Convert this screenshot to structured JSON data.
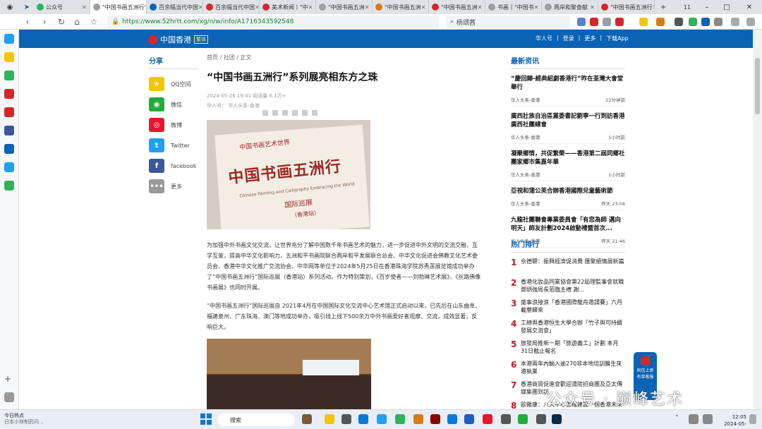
{
  "browser": {
    "tabs": [
      {
        "title": "公众号",
        "color": "#2fb45a",
        "active": false
      },
      {
        "title": "\"中国书画五洲行\"",
        "color": "#9aa0a6",
        "active": true
      },
      {
        "title": "百余幅当代中国",
        "color": "#0a63b5",
        "active": false
      },
      {
        "title": "百余幅当代中国",
        "color": "#d7262a",
        "active": false
      },
      {
        "title": "美术新闻丨\"中",
        "color": "#d7262a",
        "active": false
      },
      {
        "title": "\"中国书画五洲",
        "color": "#9aa0a6",
        "active": false
      },
      {
        "title": "\"中国书画五洲",
        "color": "#d97a16",
        "active": false
      },
      {
        "title": "\"中国书画五洲",
        "color": "#d7262a",
        "active": false
      },
      {
        "title": "书画丨\"中国书",
        "color": "#9aa0a6",
        "active": false
      },
      {
        "title": "两岸和聚奋献",
        "color": "#9aa0a6",
        "active": false
      },
      {
        "title": "\"中国书画五洲行",
        "color": "#d7262a",
        "active": false
      }
    ],
    "new_tab": "+",
    "window_count": "11",
    "url": "https://www.52hrtt.com/xg/n/w/info/A1716343592548",
    "search_text": "杨颂茜"
  },
  "site": {
    "logo_text": "中国香港",
    "logo_sub": "繁体",
    "nav": [
      "华人号",
      "登录",
      "更多",
      "下载App"
    ]
  },
  "share": {
    "title": "分享",
    "items": [
      {
        "label": "QQ空间",
        "color": "#f6c400",
        "glyph": "★"
      },
      {
        "label": "微信",
        "color": "#22ac38",
        "glyph": "◉"
      },
      {
        "label": "微博",
        "color": "#e6162d",
        "glyph": "◎"
      },
      {
        "label": "Twitter",
        "color": "#1da1f2",
        "glyph": "t"
      },
      {
        "label": "facebook",
        "color": "#3b5998",
        "glyph": "f"
      },
      {
        "label": "更多",
        "color": "#999999",
        "glyph": "•••"
      }
    ]
  },
  "article": {
    "breadcrumb": "首页 / 社团 / 正文",
    "title": "“中国书画五洲行”系列展亮相东方之珠",
    "meta": "2024-05-26 19:41 阅读量 6.1万+",
    "source": "华人号： 华人头条-香港",
    "image1": {
      "text_main": "中国书画五洲行",
      "text_top": "中国书画艺术世界",
      "text_en": "Chinese Painting and Calligraphy Embracing the World",
      "text_tour": "国际巡展",
      "text_station": "（香港站）"
    },
    "para1": "为加强中外书画文化交流，让世界充分了解中国数千年书画艺术的魅力，进一步促进中外文明的交流交融、互学互鉴，提高中华文化影响力，五洲和平书画院联合两岸和平发展联合总会、中华文化促进会佛教文化艺术委员会、香港中华文化推广交流协会、中华网等单位于2024年5月25日在香港珠海学院苏秀莲展览馆成功举办了“中国书画五洲行”国际巡展（香港站）系列活动。作为特别策划，《百岁使者——刘勃琳艺术展》、《丝路佛像书画展》也同时开展。",
    "para2": "“中国书画五洲行”国际巡展自 2021年4月在中国国际文化交流中心艺术馆正式启动以来，已先后在山东曲阜、福建泉州、广东珠海、澳门等地成功举办，吸引线上线下500余万中外书画爱好者观摩、交流，成效显著，反响巨大。"
  },
  "latest": {
    "title": "最新资讯",
    "items": [
      {
        "headline": "“慶回歸-經典紹劇香港行”昨在荃灣大會堂舉行",
        "source": "华人头条-香港",
        "time": "22分钟前"
      },
      {
        "headline": "廣西壯族自治區黨委書記劉寧一行到訪香港廣西社團總會",
        "source": "华人头条-香港",
        "time": "1小时前"
      },
      {
        "headline": "凝聚鄉情，共促繁榮——香港第二屆同鄉社團家鄉市集嘉年華",
        "source": "华人头条-香港",
        "time": "1小时前"
      },
      {
        "headline": "亞視和蒲公英合辦香港國際兒童藝術節",
        "source": "华人头条-香港",
        "time": "昨天 23:04"
      },
      {
        "headline": "九龍社團聯會專業委員會「有您為師 邁向明天」師友計劃2024啟動禮暨首次...",
        "source": "华人头条-香港",
        "time": "昨天 21:46"
      }
    ]
  },
  "hot": {
    "title": "热门排行",
    "items": [
      {
        "rank": "1",
        "headline": "佘德聰：振興經濟促消費 匯聚絕情展新篇"
      },
      {
        "rank": "2",
        "headline": "香港化妝品同業協會第22屆理監事會就職 鄧炳強局長蒞臨主禮 謝..."
      },
      {
        "rank": "3",
        "headline": "盛事浪接浪「香港國際龍舟邀請賽」六月載譽歸來"
      },
      {
        "rank": "4",
        "headline": "工總與香港恒生大學合辦「竹子與可持續發展交流會」"
      },
      {
        "rank": "5",
        "headline": "旅發局推新一期「旅遊義工」計劃 本月31日截止報名"
      },
      {
        "rank": "6",
        "headline": "本港兩年內輸入逾270非本地培訓醫生來港執業"
      },
      {
        "rank": "7",
        "headline": "香港商貿促進會歡迎湯陸招商團及亞太傳媒集團到訪"
      },
      {
        "rank": "8",
        "headline": "歐雞康：八大中心怎樣建設一個香港未來之思考"
      }
    ]
  },
  "float_btn": "同信上思有草客报",
  "watermark": "公众号 · 巅峰艺术",
  "taskbar": {
    "news_title": "今日热点",
    "news_sub": "日本小林制药问...",
    "search": "搜索",
    "time": "12:05",
    "date": "2024-05-29"
  }
}
